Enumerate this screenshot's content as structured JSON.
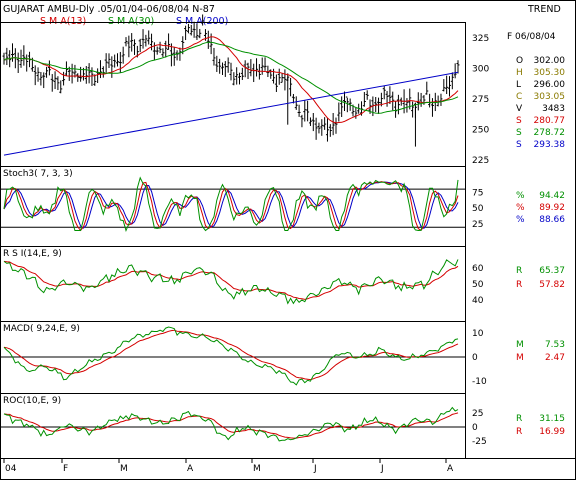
{
  "header": {
    "title": "GUJARAT AMBU-Dly .05/01/04-06/08/04  N-87",
    "right": "TREND",
    "sma_labels": [
      {
        "text": "S M A(13)",
        "color": "#d40000"
      },
      {
        "text": "S M A(30)",
        "color": "#009000"
      },
      {
        "text": "S M A(200)",
        "color": "#0000c8"
      }
    ]
  },
  "readout": {
    "date": "F 06/08/04",
    "price": [
      {
        "k": "O",
        "v": "302.00",
        "color": "#000000"
      },
      {
        "k": "H",
        "v": "305.30",
        "color": "#8a7a00"
      },
      {
        "k": "L",
        "v": "296.00",
        "color": "#000000"
      },
      {
        "k": "C",
        "v": "303.05",
        "color": "#8a7a00"
      },
      {
        "k": "V",
        "v": "3483",
        "color": "#000000"
      },
      {
        "k": "S",
        "v": "280.77",
        "color": "#d40000"
      },
      {
        "k": "S",
        "v": "278.72",
        "color": "#009000"
      },
      {
        "k": "S",
        "v": "293.38",
        "color": "#0000c8"
      }
    ],
    "stoch": [
      {
        "k": "%",
        "v": "94.42",
        "color": "#009000"
      },
      {
        "k": "%",
        "v": "89.92",
        "color": "#d40000"
      },
      {
        "k": "%",
        "v": "88.66",
        "color": "#0000c8"
      }
    ],
    "rsi": [
      {
        "k": "R",
        "v": "65.37",
        "color": "#009000"
      },
      {
        "k": "R",
        "v": "57.82",
        "color": "#d40000"
      }
    ],
    "macd": [
      {
        "k": "M",
        "v": "7.53",
        "color": "#009000"
      },
      {
        "k": "M",
        "v": "2.47",
        "color": "#d40000"
      }
    ],
    "roc": [
      {
        "k": "R",
        "v": "31.15",
        "color": "#009000"
      },
      {
        "k": "R",
        "v": "16.99",
        "color": "#d40000"
      }
    ]
  },
  "x_labels": [
    "04",
    "F",
    "M",
    "A",
    "M",
    "J",
    "J",
    "A"
  ],
  "chart_data": {
    "type": "line",
    "x_months": [
      "Jan",
      "Feb",
      "Mar",
      "Apr",
      "May",
      "Jun",
      "Jul",
      "Aug"
    ],
    "price": {
      "ylim": [
        225,
        335
      ],
      "ticks": [
        325,
        300,
        275,
        250,
        225
      ],
      "close_anchors": [
        [
          0,
          305
        ],
        [
          5,
          312
        ],
        [
          10,
          300
        ],
        [
          15,
          295
        ],
        [
          20,
          290
        ],
        [
          25,
          298
        ],
        [
          30,
          292
        ],
        [
          35,
          300
        ],
        [
          40,
          308
        ],
        [
          45,
          320
        ],
        [
          50,
          322
        ],
        [
          55,
          318
        ],
        [
          60,
          310
        ],
        [
          65,
          330
        ],
        [
          70,
          335
        ],
        [
          73,
          315
        ],
        [
          76,
          300
        ],
        [
          80,
          298
        ],
        [
          85,
          296
        ],
        [
          90,
          302
        ],
        [
          95,
          292
        ],
        [
          100,
          290
        ],
        [
          105,
          262
        ],
        [
          110,
          255
        ],
        [
          115,
          250
        ],
        [
          120,
          272
        ],
        [
          125,
          268
        ],
        [
          130,
          274
        ],
        [
          135,
          278
        ],
        [
          140,
          270
        ],
        [
          145,
          272
        ],
        [
          150,
          275
        ],
        [
          155,
          278
        ],
        [
          160,
          303
        ]
      ],
      "sma200_endpoints": [
        [
          0,
          229
        ],
        [
          160,
          297
        ]
      ]
    },
    "stochastic": {
      "label": "Stoch3( 7, 3, 3)",
      "ticks": [
        75,
        50,
        25
      ],
      "bands": [
        20,
        80
      ],
      "last": [
        94.42,
        89.92,
        88.66
      ]
    },
    "rsi": {
      "label": "R S I(14,E, 9)",
      "ticks": [
        60,
        50,
        40
      ],
      "anchors": [
        [
          0,
          62
        ],
        [
          8,
          56
        ],
        [
          15,
          45
        ],
        [
          22,
          52
        ],
        [
          30,
          47
        ],
        [
          38,
          55
        ],
        [
          45,
          60
        ],
        [
          52,
          55
        ],
        [
          60,
          51
        ],
        [
          68,
          60
        ],
        [
          73,
          56
        ],
        [
          80,
          42
        ],
        [
          88,
          48
        ],
        [
          95,
          45
        ],
        [
          103,
          38
        ],
        [
          110,
          44
        ],
        [
          118,
          52
        ],
        [
          125,
          47
        ],
        [
          133,
          53
        ],
        [
          140,
          48
        ],
        [
          148,
          50
        ],
        [
          155,
          62
        ],
        [
          160,
          65
        ]
      ],
      "last": [
        65.37,
        57.82
      ]
    },
    "macd": {
      "label": "MACD( 9,24,E, 9)",
      "ticks": [
        10,
        0,
        -10
      ],
      "anchors": [
        [
          0,
          4
        ],
        [
          8,
          -6
        ],
        [
          15,
          -4
        ],
        [
          22,
          -9
        ],
        [
          30,
          -2
        ],
        [
          38,
          2
        ],
        [
          45,
          8
        ],
        [
          52,
          10
        ],
        [
          58,
          12
        ],
        [
          65,
          9
        ],
        [
          72,
          8
        ],
        [
          80,
          3
        ],
        [
          88,
          -3
        ],
        [
          95,
          -5
        ],
        [
          103,
          -11
        ],
        [
          110,
          -8
        ],
        [
          118,
          2
        ],
        [
          125,
          0
        ],
        [
          133,
          3
        ],
        [
          140,
          -1
        ],
        [
          148,
          1
        ],
        [
          155,
          5
        ],
        [
          160,
          7.5
        ]
      ],
      "last": [
        7.53,
        2.47
      ]
    },
    "roc": {
      "label": "ROC(10,E, 9)",
      "ticks": [
        25,
        0,
        -25
      ],
      "anchors": [
        [
          0,
          20
        ],
        [
          8,
          5
        ],
        [
          15,
          -15
        ],
        [
          22,
          5
        ],
        [
          30,
          -10
        ],
        [
          38,
          12
        ],
        [
          45,
          20
        ],
        [
          52,
          10
        ],
        [
          58,
          8
        ],
        [
          65,
          25
        ],
        [
          72,
          12
        ],
        [
          78,
          -20
        ],
        [
          85,
          0
        ],
        [
          92,
          -12
        ],
        [
          100,
          -25
        ],
        [
          108,
          -10
        ],
        [
          115,
          8
        ],
        [
          122,
          -5
        ],
        [
          130,
          15
        ],
        [
          138,
          -5
        ],
        [
          145,
          12
        ],
        [
          152,
          10
        ],
        [
          156,
          30
        ],
        [
          160,
          31
        ]
      ],
      "last": [
        31.15,
        16.99
      ]
    }
  }
}
